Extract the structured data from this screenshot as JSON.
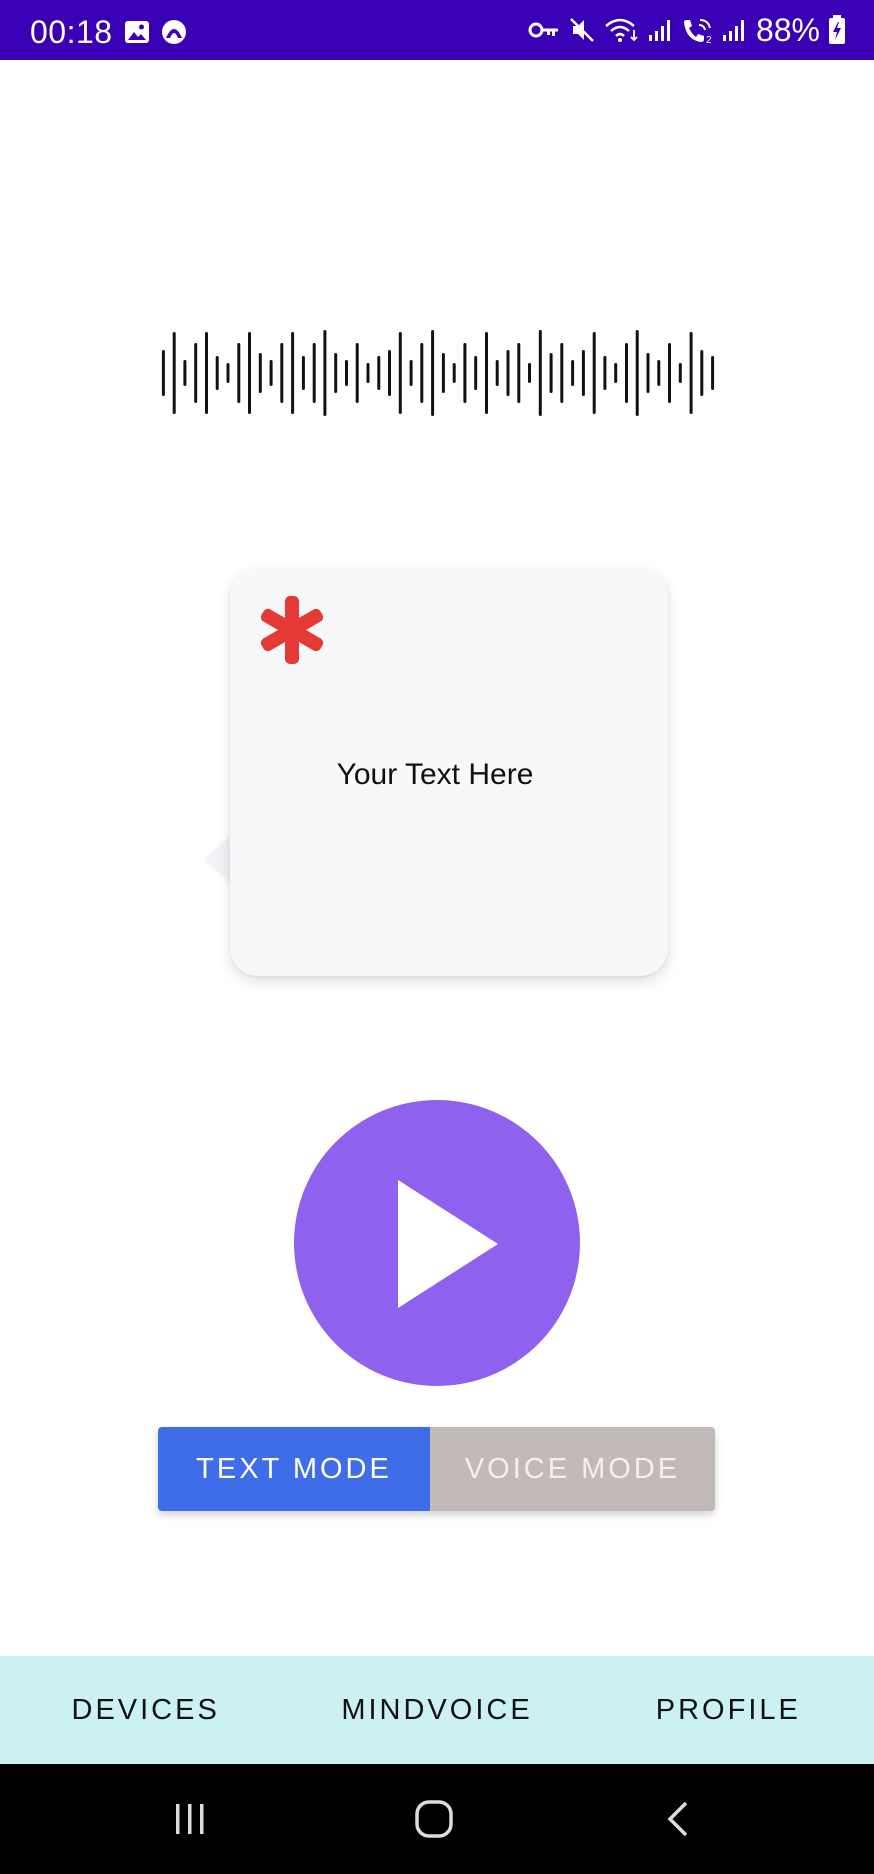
{
  "status_bar": {
    "time": "00:18",
    "battery": "88%",
    "left_icons": [
      "gallery-icon",
      "app-notification-icon"
    ],
    "right_icons": [
      "vpn-key-icon",
      "mute-icon",
      "wifi-calling-icon",
      "signal-icon",
      "volte-icon",
      "signal-icon-2",
      "battery-charging-icon"
    ],
    "background_color": "#3A00B5"
  },
  "waveform": {
    "icon": "audio-waveform-icon"
  },
  "speech_card": {
    "icon": "asterisk-icon",
    "icon_color": "#E53935",
    "text": "Your Text Here"
  },
  "play_button": {
    "icon": "play-icon",
    "color": "#8E62EE"
  },
  "mode_toggle": {
    "text_mode_label": "TEXT MODE",
    "voice_mode_label": "VOICE MODE",
    "selected": "TEXT MODE",
    "active_color": "#3F6CE8",
    "inactive_color": "#C2BAB8"
  },
  "bottom_nav": {
    "items": [
      {
        "label": "DEVICES"
      },
      {
        "label": "MINDVOICE"
      },
      {
        "label": "PROFILE"
      }
    ],
    "background_color": "#CBF1F3"
  },
  "system_nav": {
    "buttons": [
      "recent-apps-icon",
      "home-icon",
      "back-icon"
    ]
  }
}
